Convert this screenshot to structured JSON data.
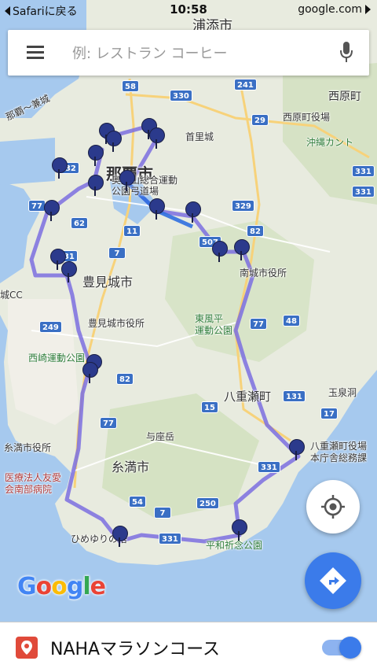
{
  "status_bar": {
    "back_label": "Safariに戻る",
    "time": "10:58",
    "url": "google.com"
  },
  "search": {
    "placeholder": "例: レストラン コーヒー",
    "top_place": "浦添市"
  },
  "map": {
    "places": [
      {
        "id": "naha",
        "text": "那覇市"
      },
      {
        "id": "tomigusuku",
        "text": "豊見城市"
      },
      {
        "id": "itoman",
        "text": "糸満市"
      },
      {
        "id": "yaese",
        "text": "八重瀬町"
      },
      {
        "id": "nishihara",
        "text": "西原町"
      },
      {
        "id": "shuri",
        "text": "首里城"
      },
      {
        "id": "nishihara_office",
        "text": "西原町役場"
      },
      {
        "id": "okinawa_country",
        "text": "沖縄カント"
      },
      {
        "id": "okuyama",
        "text": "奥武山総合運動\n公園弓道場"
      },
      {
        "id": "nanjo_office",
        "text": "南城市役所"
      },
      {
        "id": "tomi_office",
        "text": "豊見城市役所"
      },
      {
        "id": "tofuhira",
        "text": "東風平\n運動公園"
      },
      {
        "id": "nishizaki",
        "text": "西崎運動公園"
      },
      {
        "id": "tamasendo",
        "text": "玉泉洞"
      },
      {
        "id": "itoman_office",
        "text": "糸満市役所"
      },
      {
        "id": "yaese_office",
        "text": "八重瀬町役場\n本庁舎総務課"
      },
      {
        "id": "yozadake",
        "text": "与座岳"
      },
      {
        "id": "hospital",
        "text": "医療法人友愛\n会南部病院"
      },
      {
        "id": "himeyuri",
        "text": "ひめゆりの塔"
      },
      {
        "id": "heiwa",
        "text": "平和祈念公園"
      },
      {
        "id": "jo_cc",
        "text": "城CC"
      },
      {
        "id": "naha_bridge",
        "text": "那覇～兼城"
      }
    ],
    "routes": [
      "58",
      "330",
      "241",
      "29",
      "332",
      "62",
      "329",
      "82",
      "11",
      "507",
      "7",
      "231",
      "249",
      "48",
      "77",
      "82",
      "131",
      "15",
      "17",
      "77",
      "331",
      "54",
      "250",
      "7",
      "331",
      "331",
      "331",
      "77"
    ]
  },
  "brand": {
    "logo": "Google"
  },
  "bottom": {
    "layer_title": "NAHAマラソンコース",
    "toggle_on": true
  },
  "colors": {
    "route": "#7b6fe0",
    "pin": "#2b3a8c",
    "fab_blue": "#3b7bea",
    "water": "#a6c9ee"
  }
}
